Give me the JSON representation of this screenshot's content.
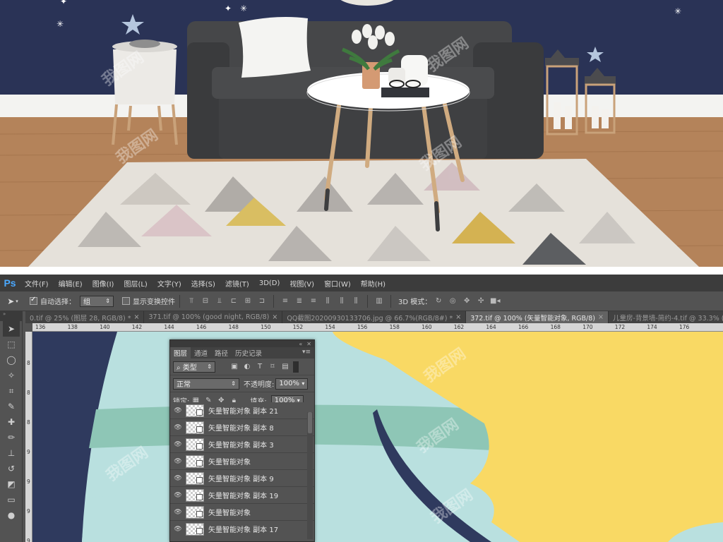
{
  "app": {
    "logo": "Ps"
  },
  "menu": [
    "文件(F)",
    "编辑(E)",
    "图像(I)",
    "图层(L)",
    "文字(Y)",
    "选择(S)",
    "滤镜(T)",
    "3D(D)",
    "视图(V)",
    "窗口(W)",
    "帮助(H)"
  ],
  "options": {
    "auto_select_label": "自动选择：",
    "auto_select_checked": true,
    "group_value": "组",
    "show_transform_label": "显示变换控件",
    "show_transform_checked": false,
    "mode_3d_label": "3D 模式："
  },
  "tabs": [
    {
      "label": "0.tif @ 25% (图层 28, RGB/8) *",
      "active": false
    },
    {
      "label": "371.tif @ 100% (good night, RGB/8)",
      "active": false
    },
    {
      "label": "QQ截图20200930133706.jpg @ 66.7%(RGB/8#) *",
      "active": false
    },
    {
      "label": "372.tif @ 100% (矢量智能对象, RGB/8)",
      "active": true
    },
    {
      "label": "儿童房-背景墙-简约-4.tif @ 33.3% (图层 1, RG",
      "active": false
    }
  ],
  "ruler_top": [
    "136",
    "138",
    "140",
    "142",
    "144",
    "146",
    "148",
    "150",
    "152",
    "154",
    "156",
    "158",
    "160",
    "162",
    "164",
    "166",
    "168",
    "170",
    "172",
    "174",
    "176"
  ],
  "ruler_left": [
    "8",
    "8",
    "8",
    "9",
    "9",
    "9",
    "9"
  ],
  "layers_panel": {
    "tabs": [
      "图层",
      "通道",
      "路径",
      "历史记录"
    ],
    "filter_label": "类型",
    "blend_mode": "正常",
    "opacity_label": "不透明度:",
    "opacity_value": "100%",
    "lock_label": "锁定:",
    "fill_label": "填充:",
    "fill_value": "100%",
    "layers": [
      "矢量智能对象 副本 21",
      "矢量智能对象 副本 8",
      "矢量智能对象 副本 3",
      "矢量智能对象",
      "矢量智能对象 副本 9",
      "矢量智能对象 副本 19",
      "矢量智能对象",
      "矢量智能对象 副本 17"
    ]
  },
  "watermark": "我图网",
  "colors": {
    "wall": "#2a3356",
    "floor": "#b07e50",
    "sofa": "#3d3e40",
    "canvas_navy": "#2f3a5e",
    "canvas_mint": "#b9e0df",
    "canvas_teal": "#8ec6b6",
    "canvas_yellow": "#f9d964",
    "ps_blue": "#4aa8ff"
  }
}
